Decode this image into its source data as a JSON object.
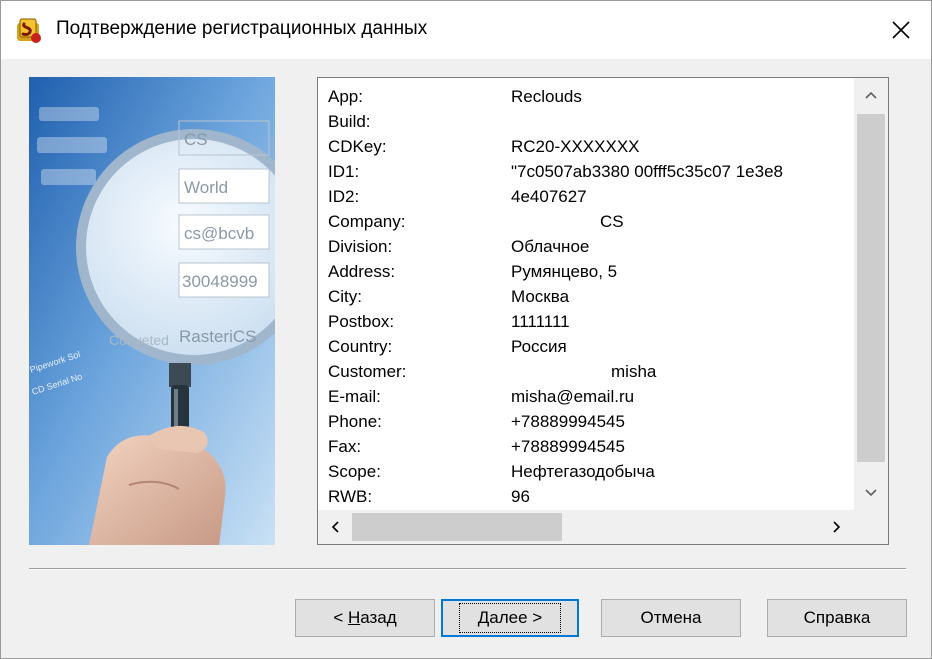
{
  "window": {
    "title": "Подтверждение регистрационных данных"
  },
  "details": [
    {
      "key": "App:",
      "value": "Reclouds"
    },
    {
      "key": "Build:",
      "value": ""
    },
    {
      "key": "CDKey:",
      "value": "RC20-XXXXXXX"
    },
    {
      "key": "ID1:",
      "value": "\"7c0507ab3380 00fff5c35c07 1e3e8"
    },
    {
      "key": "ID2:",
      "value": "4e407627"
    },
    {
      "key": "Company:",
      "value": "CS"
    },
    {
      "key": "Division:",
      "value": "Облачное"
    },
    {
      "key": "Address:",
      "value": "Румянцево, 5"
    },
    {
      "key": "City:",
      "value": "Москва"
    },
    {
      "key": "Postbox:",
      "value": "1111111"
    },
    {
      "key": "Country:",
      "value": "Россия"
    },
    {
      "key": "Customer:",
      "value": "misha"
    },
    {
      "key": "E-mail:",
      "value": "misha@email.ru"
    },
    {
      "key": "Phone:",
      "value": "+78889994545"
    },
    {
      "key": "Fax:",
      "value": "+78889994545"
    },
    {
      "key": "Scope:",
      "value": "Нефтегазодобыча"
    },
    {
      "key": "RWB:",
      "value": "96"
    }
  ],
  "illustration": {
    "field_texts": [
      "CS",
      "World",
      "cs@bcvb",
      "30048999",
      "RasteriCS",
      "Conveted",
      "Pipework Sol",
      "CD Serial No"
    ]
  },
  "buttons": {
    "back": {
      "prefix": "< ",
      "accel": "Н",
      "rest": "азад"
    },
    "next": {
      "accel": "Д",
      "rest": "алее >"
    },
    "cancel": "Отмена",
    "help": "Справка"
  },
  "colors": {
    "default_button_border": "#0078d7",
    "dialog_bg": "#f0f0f0"
  }
}
